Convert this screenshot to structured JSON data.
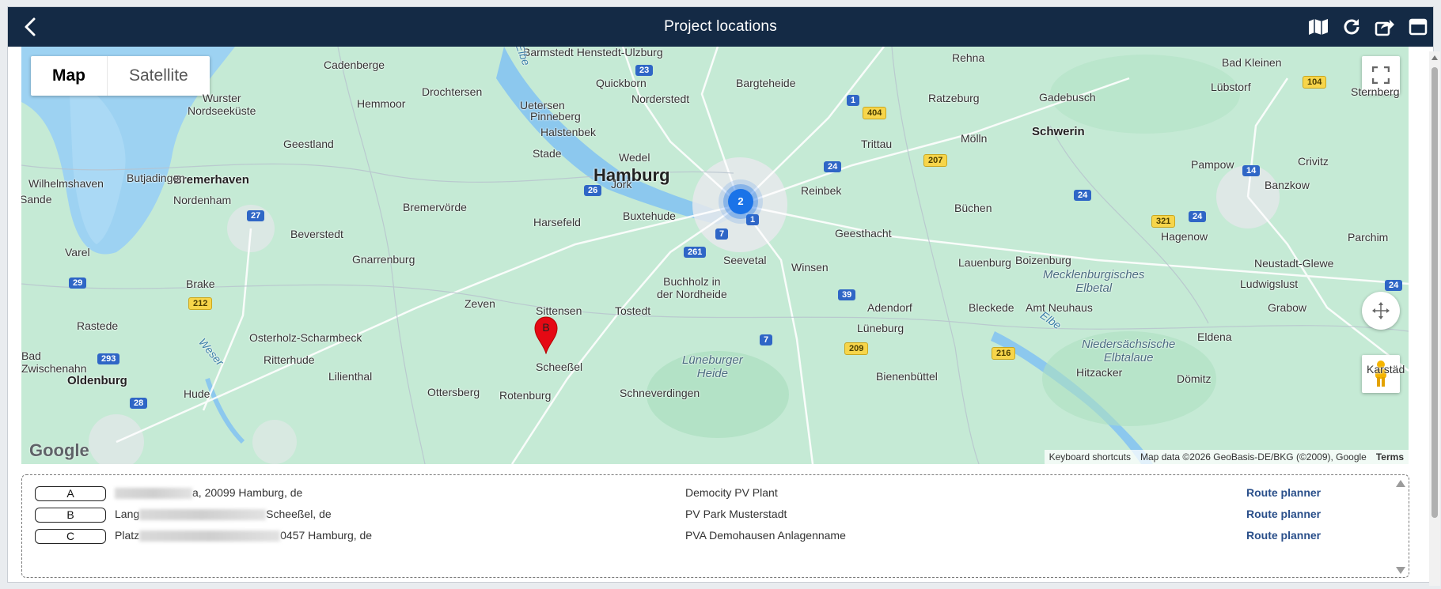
{
  "header": {
    "title": "Project locations",
    "back_icon": "chevron-left-icon",
    "tools": [
      "map-icon",
      "refresh-icon",
      "share-icon",
      "window-icon"
    ]
  },
  "map": {
    "type_control": {
      "map_label": "Map",
      "satellite_label": "Satellite",
      "selected": "Map"
    },
    "cluster": {
      "count": "2"
    },
    "pin": {
      "label": "B",
      "color": "#e50914"
    },
    "google_logo": "Google",
    "attribution": {
      "shortcuts": "Keyboard shortcuts",
      "data": "Map data ©2026 GeoBasis-DE/BKG (©2009), Google",
      "terms": "Terms"
    },
    "places": {
      "hamburg": "Hamburg",
      "bremerhaven": "Bremerhaven",
      "schwerin": "Schwerin",
      "oldenburg": "Oldenburg",
      "cadenberge": "Cadenberge",
      "barmstedt": "Barmstedt Henstedt-Ulzburg",
      "rehna": "Rehna",
      "badkleinen": "Bad Kleinen",
      "wurster": "Wurster\nNordseeküste",
      "drochtersen": "Drochtersen",
      "hemmoor": "Hemmoor",
      "uetersen": "Uetersen",
      "quickborn": "Quickborn",
      "norderstedt": "Norderstedt",
      "bargteheide": "Bargteheide",
      "ratzeburg": "Ratzeburg",
      "gadebusch": "Gadebusch",
      "luebstorf": "Lübstorf",
      "sternberg": "Sternberg",
      "pinneberg": "Pinneberg",
      "halstenbek": "Halstenbek",
      "geestland": "Geestland",
      "stade": "Stade",
      "wedel": "Wedel",
      "trittau": "Trittau",
      "moelln": "Mölln",
      "wilhelmshaven": "Wilhelmshaven",
      "butjadingen": "Butjadingen",
      "jork": "Jork",
      "reinbek": "Reinbek",
      "pampow": "Pampow",
      "crivitz": "Crivitz",
      "sande": "Sande",
      "nordenham": "Nordenham",
      "bremervoerde": "Bremervörde",
      "buxtehude": "Buxtehude",
      "buechen": "Büchen",
      "banzkow": "Banzkow",
      "harsefeld": "Harsefeld",
      "beverstedt": "Beverstedt",
      "geesthacht": "Geesthacht",
      "hagenow": "Hagenow",
      "parchim": "Parchim",
      "varel": "Varel",
      "gnarrenburg": "Gnarrenburg",
      "seevetal": "Seevetal",
      "lauenburg": "Lauenburg",
      "boizenburg": "Boizenburg",
      "neustadt": "Neustadt-Glewe",
      "winsen": "Winsen",
      "brake": "Brake",
      "buchholz": "Buchholz in\nder Nordheide",
      "mecklenburgisches": "Mecklenburgisches\nElbetal",
      "ludwigslust": "Ludwigslust",
      "zeven": "Zeven",
      "sittensen": "Sittensen",
      "tostedt": "Tostedt",
      "adendorf": "Adendorf",
      "bleckede": "Bleckede",
      "amtneuhaus": "Amt Neuhaus",
      "grabow": "Grabow",
      "rastede": "Rastede",
      "osterholz": "Osterholz-Scharmbeck",
      "lueneburg": "Lüneburg",
      "eldena": "Eldena",
      "badzwischenahn": "Bad\nZwischenahn",
      "ritterhude": "Ritterhude",
      "niedersaechsische": "Niedersächsische\nElbtalaue",
      "scheessel": "Scheeßel",
      "lueneburgerheide": "Lüneburger\nHeide",
      "lilienthal": "Lilienthal",
      "bienenbuettel": "Bienenbüttel",
      "hitzacker": "Hitzacker",
      "karstaedt": "Karstäd",
      "doemitz": "Dömitz",
      "hude": "Hude",
      "ottersberg": "Ottersberg",
      "rotenburg": "Rotenburg",
      "schneverdingen": "Schneverdingen",
      "elbe": "Elbe",
      "weser": "Weser"
    },
    "shields": {
      "a23": "23",
      "a1a": "1",
      "a24a": "24",
      "a24b": "24",
      "a24c": "24",
      "a26": "26",
      "a1b": "1",
      "a7a": "7",
      "a261": "261",
      "a27": "27",
      "a29": "29",
      "a39": "39",
      "a14": "14",
      "a293": "293",
      "a7b": "7",
      "a28": "28",
      "b404": "404",
      "b104": "104",
      "b207": "207",
      "b321": "321",
      "b212": "212",
      "b209": "209",
      "b216": "216"
    }
  },
  "locations": [
    {
      "letter": "A",
      "address_visible": "a, 20099 Hamburg, de",
      "address_prefix": "",
      "project": "Democity PV Plant",
      "route_label": "Route planner"
    },
    {
      "letter": "B",
      "address_visible": "Scheeßel, de",
      "address_prefix": "Lang",
      "project": "PV Park Musterstadt",
      "route_label": "Route planner"
    },
    {
      "letter": "C",
      "address_visible": "0457 Hamburg, de",
      "address_prefix": "Platz",
      "project": "PVA Demohausen Anlagenname",
      "route_label": "Route planner"
    }
  ]
}
